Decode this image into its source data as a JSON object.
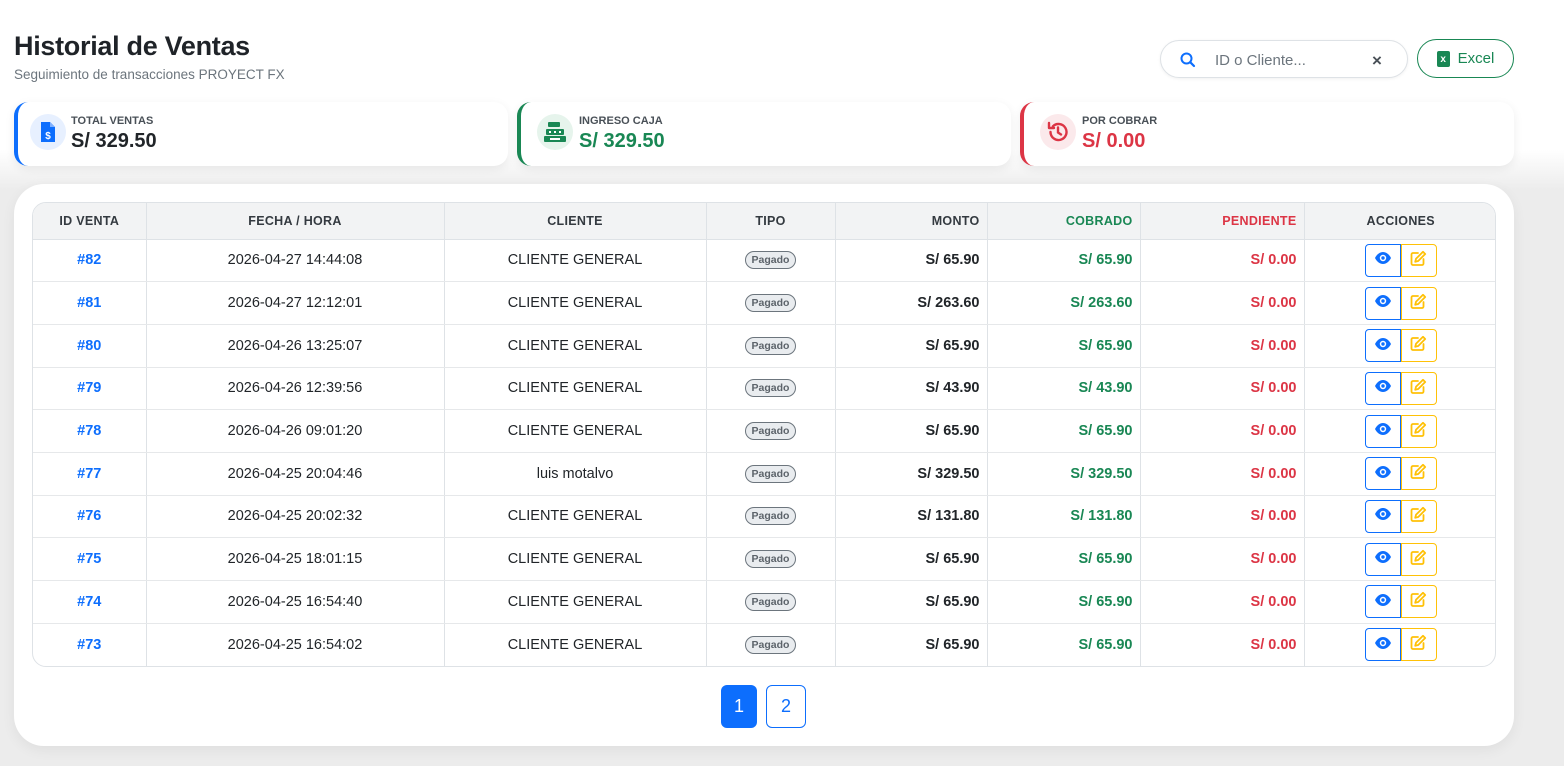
{
  "header": {
    "title": "Historial de Ventas",
    "subtitle": "Seguimiento de transacciones PROYECT FX"
  },
  "search": {
    "placeholder": "ID o Cliente...",
    "value": ""
  },
  "toolbar": {
    "excel_label": "Excel"
  },
  "stats": [
    {
      "label": "TOTAL VENTAS",
      "value": "S/ 329.50",
      "icon": "invoice-dollar-icon",
      "color": "#0d6efd"
    },
    {
      "label": "INGRESO CAJA",
      "value": "S/ 329.50",
      "icon": "cash-register-icon",
      "color": "#198754"
    },
    {
      "label": "POR COBRAR",
      "value": "S/ 0.00",
      "icon": "history-icon",
      "color": "#dc3545"
    }
  ],
  "table": {
    "headers": [
      "ID VENTA",
      "FECHA / HORA",
      "CLIENTE",
      "TIPO",
      "MONTO",
      "COBRADO",
      "PENDIENTE",
      "ACCIONES"
    ],
    "rows": [
      {
        "id": "#82",
        "fecha": "2026-04-27 14:44:08",
        "cliente": "CLIENTE GENERAL",
        "tipo": "Pagado",
        "monto": "S/ 65.90",
        "cobrado": "S/ 65.90",
        "pendiente": "S/ 0.00"
      },
      {
        "id": "#81",
        "fecha": "2026-04-27 12:12:01",
        "cliente": "CLIENTE GENERAL",
        "tipo": "Pagado",
        "monto": "S/ 263.60",
        "cobrado": "S/ 263.60",
        "pendiente": "S/ 0.00"
      },
      {
        "id": "#80",
        "fecha": "2026-04-26 13:25:07",
        "cliente": "CLIENTE GENERAL",
        "tipo": "Pagado",
        "monto": "S/ 65.90",
        "cobrado": "S/ 65.90",
        "pendiente": "S/ 0.00"
      },
      {
        "id": "#79",
        "fecha": "2026-04-26 12:39:56",
        "cliente": "CLIENTE GENERAL",
        "tipo": "Pagado",
        "monto": "S/ 43.90",
        "cobrado": "S/ 43.90",
        "pendiente": "S/ 0.00"
      },
      {
        "id": "#78",
        "fecha": "2026-04-26 09:01:20",
        "cliente": "CLIENTE GENERAL",
        "tipo": "Pagado",
        "monto": "S/ 65.90",
        "cobrado": "S/ 65.90",
        "pendiente": "S/ 0.00"
      },
      {
        "id": "#77",
        "fecha": "2026-04-25 20:04:46",
        "cliente": "luis motalvo",
        "tipo": "Pagado",
        "monto": "S/ 329.50",
        "cobrado": "S/ 329.50",
        "pendiente": "S/ 0.00"
      },
      {
        "id": "#76",
        "fecha": "2026-04-25 20:02:32",
        "cliente": "CLIENTE GENERAL",
        "tipo": "Pagado",
        "monto": "S/ 131.80",
        "cobrado": "S/ 131.80",
        "pendiente": "S/ 0.00"
      },
      {
        "id": "#75",
        "fecha": "2026-04-25 18:01:15",
        "cliente": "CLIENTE GENERAL",
        "tipo": "Pagado",
        "monto": "S/ 65.90",
        "cobrado": "S/ 65.90",
        "pendiente": "S/ 0.00"
      },
      {
        "id": "#74",
        "fecha": "2026-04-25 16:54:40",
        "cliente": "CLIENTE GENERAL",
        "tipo": "Pagado",
        "monto": "S/ 65.90",
        "cobrado": "S/ 65.90",
        "pendiente": "S/ 0.00"
      },
      {
        "id": "#73",
        "fecha": "2026-04-25 16:54:02",
        "cliente": "CLIENTE GENERAL",
        "tipo": "Pagado",
        "monto": "S/ 65.90",
        "cobrado": "S/ 65.90",
        "pendiente": "S/ 0.00"
      }
    ]
  },
  "pagination": {
    "pages": [
      "1",
      "2"
    ],
    "current": "1"
  }
}
